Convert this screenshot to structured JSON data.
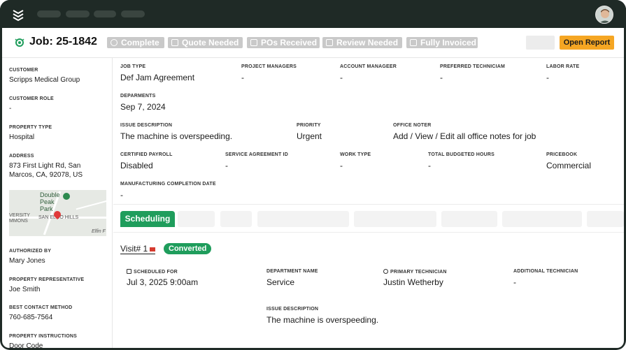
{
  "header": {
    "job_title": "Job: 25-1842",
    "statuses": [
      {
        "label": "Complete",
        "icon": "github-icon"
      },
      {
        "label": "Quote Needed",
        "icon": "calculator-icon"
      },
      {
        "label": "POs Received",
        "icon": "chat-icon"
      },
      {
        "label": "Review Needed",
        "icon": "document-icon"
      },
      {
        "label": "Fully Invoiced",
        "icon": "document-icon"
      }
    ],
    "open_report_label": "Open Report"
  },
  "sidebar": {
    "customer_label": "Customer",
    "customer": "Scripps Medical Group",
    "customer_role_label": "Customer Role",
    "customer_role": "-",
    "property_type_label": "Property Type",
    "property_type": "Hospital",
    "address_label": "Address",
    "address": "873 First Light Rd, San Marcos, CA, 92078, US",
    "map": {
      "park": "Double Peak Park",
      "area_left_1": "VERSITY",
      "area_left_2": "MMONS",
      "area": "SAN ELIJO HILLS",
      "area_right": "Elfin F"
    },
    "authorized_by_label": "Authorized By",
    "authorized_by": "Mary Jones",
    "property_rep_label": "Property Representative",
    "property_rep": "Joe Smith",
    "best_contact_label": "Best Contact Method",
    "best_contact": "760-685-7564",
    "property_instructions_label": "Property Instructions",
    "property_instructions": "Door Code"
  },
  "details": {
    "job_type_label": "Job Type",
    "job_type": "Def Jam Agreement",
    "project_managers_label": "Project Managers",
    "project_managers": "-",
    "account_manager_label": "Account Manageer",
    "account_manager": "-",
    "preferred_tech_label": "Preferred Techniciam",
    "preferred_tech": "-",
    "labor_rate_label": "Labor Rate",
    "labor_rate": "-",
    "deparments_label": "Deparments",
    "deparments": "Sep 7, 2024",
    "issue_desc_label": "Issue Description",
    "issue_desc": "The machine is overspeeding.",
    "priority_label": "Priority",
    "priority": "Urgent",
    "office_notes_label": "Office Noter",
    "office_notes": "Add / View / Edit all office notes for job",
    "certified_payroll_label": "Certified Payroll",
    "certified_payroll": "Disabled",
    "service_agreement_label": "Service Agreement ID",
    "service_agreement": "-",
    "work_type_label": "Work Type",
    "work_type": "-",
    "budgeted_hours_label": "Total Budgeted Hours",
    "budgeted_hours": "-",
    "pricebook_label": "Pricebook",
    "pricebook": "Commercial",
    "mfg_date_label": "Manufacturing Completion Date",
    "mfg_date": "-"
  },
  "tabs": {
    "active": "Scheduling"
  },
  "visit": {
    "link": "Visit# 1",
    "status": "Converted",
    "scheduled_label": "Scheduled For",
    "scheduled": "Jul 3, 2025 9:00am",
    "department_label": "Department Name",
    "department": "Service",
    "primary_tech_label": "Primary Technician",
    "primary_tech": "Justin Wetherby",
    "additional_tech_label": "Additional Technician",
    "additional_tech": "-",
    "issue_label": "Issue Description",
    "issue": "The machine is overspeeding."
  },
  "colors": {
    "brand_green": "#1f9d5c",
    "accent_orange": "#f5a623",
    "status_gray": "#c9c9c9",
    "frame_dark": "#1f2a26"
  }
}
